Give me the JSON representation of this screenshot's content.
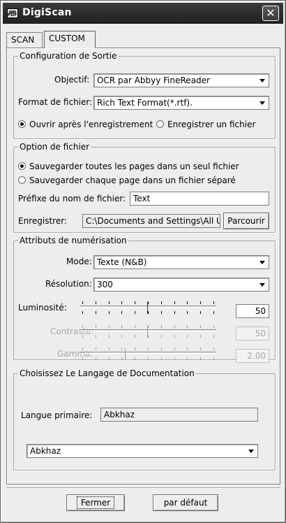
{
  "window": {
    "title": "DigiScan",
    "close_glyph": "✕",
    "icon": "scanner-pdf-icon"
  },
  "tabs": [
    {
      "label": "SCAN"
    },
    {
      "label": "CUSTOM",
      "active": true
    }
  ],
  "config": {
    "legend": "Configuration de Sortie",
    "objectif_label": "Objectif:",
    "objectif_value": "OCR par Abbyy FineReader",
    "format_label": "Format de fichier:",
    "format_value": "Rich Text Format(*.rtf).",
    "open_after_label": "Ouvrir après l'enregistrement",
    "save_file_label": "Enregistrer un fichier"
  },
  "file_option": {
    "legend": "Option de fichier",
    "all_pages_label": "Sauvegarder toutes les pages dans un seul fichier",
    "each_page_label": "Sauvegarder chaque page dans un fichier séparé",
    "prefix_label": "Préfixe du nom de fichier:",
    "prefix_value": "Text",
    "save_label": "Enregistrer:",
    "save_path": "C:\\Documents and Settings\\All U",
    "browse_label": "Parcourir"
  },
  "scan_attributes": {
    "legend": "Attributs de numérisation",
    "mode_label": "Mode:",
    "mode_value": "Texte (N&B)",
    "resolution_label": "Résolution:",
    "resolution_value": "300",
    "brightness_label": "Luminosité:",
    "brightness_value": "50",
    "contrast_label": "Contraste:",
    "contrast_value": "50",
    "gamma_label": "Gamma:",
    "gamma_value": "2.00"
  },
  "language": {
    "legend": "Choisissez Le Langage de Documentation",
    "primary_label": "Langue primaire:",
    "primary_value": "Abkhaz",
    "select_value": "Abkhaz"
  },
  "buttons": {
    "close_label": "Fermer",
    "default_label": "par défaut"
  },
  "colors": {
    "titlebar": "#2b2b2b",
    "window_bg": "#ededed",
    "disabled_text": "#a8a8a8"
  }
}
